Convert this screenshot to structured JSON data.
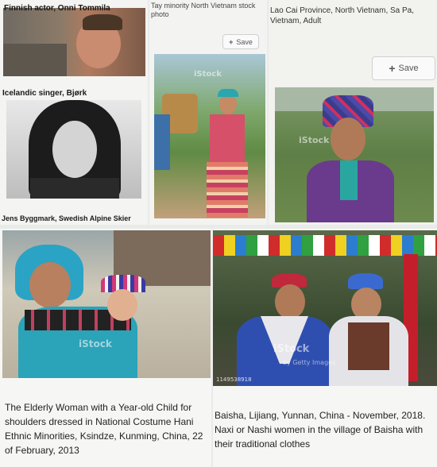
{
  "top_left": {
    "caption_1": "Finnish actor, Onni Tommila",
    "caption_2": "Icelandic singer, Bjørk",
    "caption_3": "Jens Byggmark, Swedish Alpine Skier"
  },
  "top_middle": {
    "caption": "Tay minority North Vietnam stock photo",
    "save_label": "Save",
    "watermark": "iStock"
  },
  "top_right": {
    "caption": "Lao Cai Province, North Vietnam, Sa Pa, Vietnam, Adult",
    "save_label": "Save",
    "watermark": "iStock"
  },
  "bottom_left": {
    "caption": "The Elderly Woman with a Year-old Child for shoulders dressed in National Costume Hani Ethnic Minorities, Ksindze, Kunming, China, 22 of February, 2013",
    "watermark": "iStock"
  },
  "bottom_right": {
    "caption": "Baisha, Lijiang, Yunnan, China - November, 2018. Naxi or Nashi women in the village of Baisha with their traditional clothes",
    "watermark": "iStock",
    "credit": "by Getty Images",
    "image_id": "1149538918"
  }
}
